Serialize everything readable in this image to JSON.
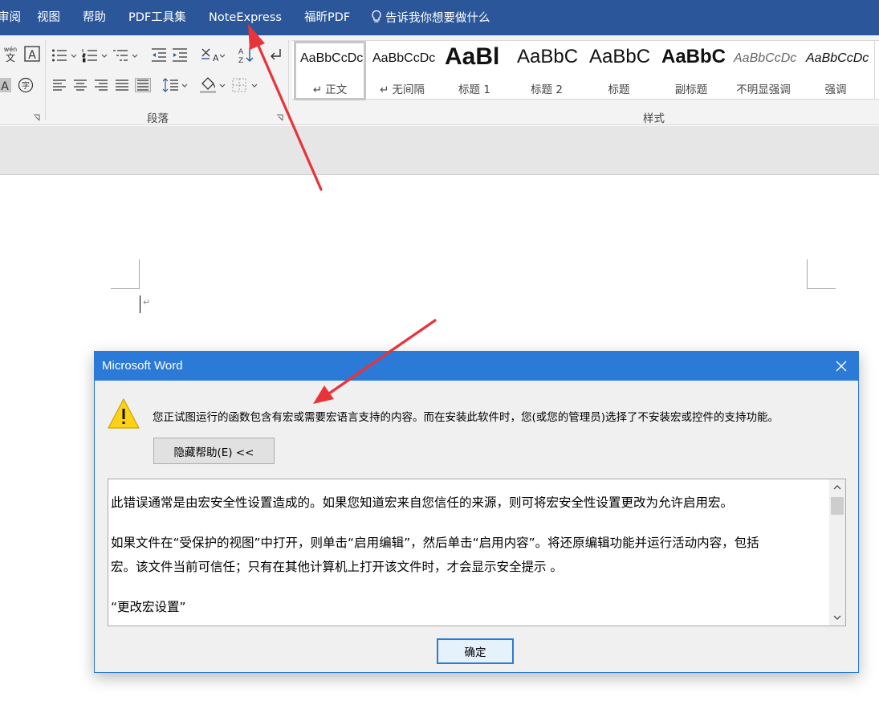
{
  "menubar": {
    "items": [
      "审阅",
      "视图",
      "帮助",
      "PDF工具集",
      "NoteExpress",
      "福昕PDF"
    ],
    "tell_me": "告诉我你想要做什么"
  },
  "ribbon": {
    "paragraph_group_label": "段落",
    "styles_group_label": "样式",
    "styles": [
      {
        "preview": "AaBbCcDc",
        "name": "↵ 正文"
      },
      {
        "preview": "AaBbCcDc",
        "name": "↵ 无间隔"
      },
      {
        "preview": "AaBl",
        "name": "标题 1"
      },
      {
        "preview": "AaBbC",
        "name": "标题 2"
      },
      {
        "preview": "AaBbC",
        "name": "标题"
      },
      {
        "preview": "AaBbC",
        "name": "副标题"
      },
      {
        "preview": "AaBbCcDc",
        "name": "不明显强调"
      },
      {
        "preview": "AaBbCcDc",
        "name": "强调"
      }
    ],
    "phonetic_icon_text": "wén",
    "phonetic_icon_char": "文",
    "char_border_icon_text": "A",
    "char_shade_icon_text": "A",
    "enclose_char_icon_text": "字"
  },
  "document": {
    "paragraph_mark": "↵"
  },
  "dialog": {
    "title": "Microsoft Word",
    "message": "您正试图运行的函数包含有宏或需要宏语言支持的内容。而在安装此软件时，您(或您的管理员)选择了不安装宏或控件的支持功能。",
    "help_button": "隐藏帮助(E) <<",
    "help_paragraphs": [
      "此错误通常是由宏安全性设置造成的。如果您知道宏来自您信任的来源，则可将宏安全性设置更改为允许启用宏。",
      "如果文件在“受保护的视图”中打开，则单击“启用编辑”，然后单击“启用内容”。将还原编辑功能并运行活动内容，包括",
      "宏。该文件当前可信任；只有在其他计算机上打开该文件时，才会显示安全提示 。",
      "“更改宏设置”"
    ],
    "ok_button": "确定"
  },
  "colors": {
    "menubar_bg": "#2b579a",
    "dialog_title_bg": "#2b7ad8",
    "annotation_arrow": "#e8333a",
    "warning_yellow": "#fcd116"
  }
}
